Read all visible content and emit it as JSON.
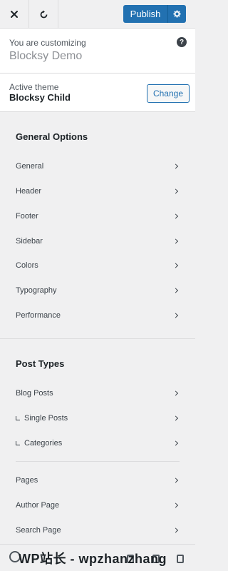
{
  "topbar": {
    "close_icon": "close-icon",
    "undo_icon": "undo-icon",
    "publish_label": "Publish",
    "settings_icon": "gear-icon",
    "accent": "#2271b1"
  },
  "customizing": {
    "label": "You are customizing",
    "title": "Blocksy Demo",
    "help_glyph": "?"
  },
  "theme": {
    "label": "Active theme",
    "name": "Blocksy Child",
    "change_label": "Change"
  },
  "general_options": {
    "heading": "General Options",
    "items": [
      {
        "label": "General"
      },
      {
        "label": "Header"
      },
      {
        "label": "Footer"
      },
      {
        "label": "Sidebar"
      },
      {
        "label": "Colors"
      },
      {
        "label": "Typography"
      },
      {
        "label": "Performance"
      }
    ]
  },
  "post_types": {
    "heading": "Post Types",
    "items": [
      {
        "label": "Blog Posts"
      },
      {
        "label": "Single Posts"
      },
      {
        "label": "Categories"
      },
      {
        "label": "Pages"
      },
      {
        "label": "Author Page"
      },
      {
        "label": "Search Page"
      }
    ]
  },
  "footer": {
    "watermark": "WP站长 - wpzhanzhang"
  }
}
